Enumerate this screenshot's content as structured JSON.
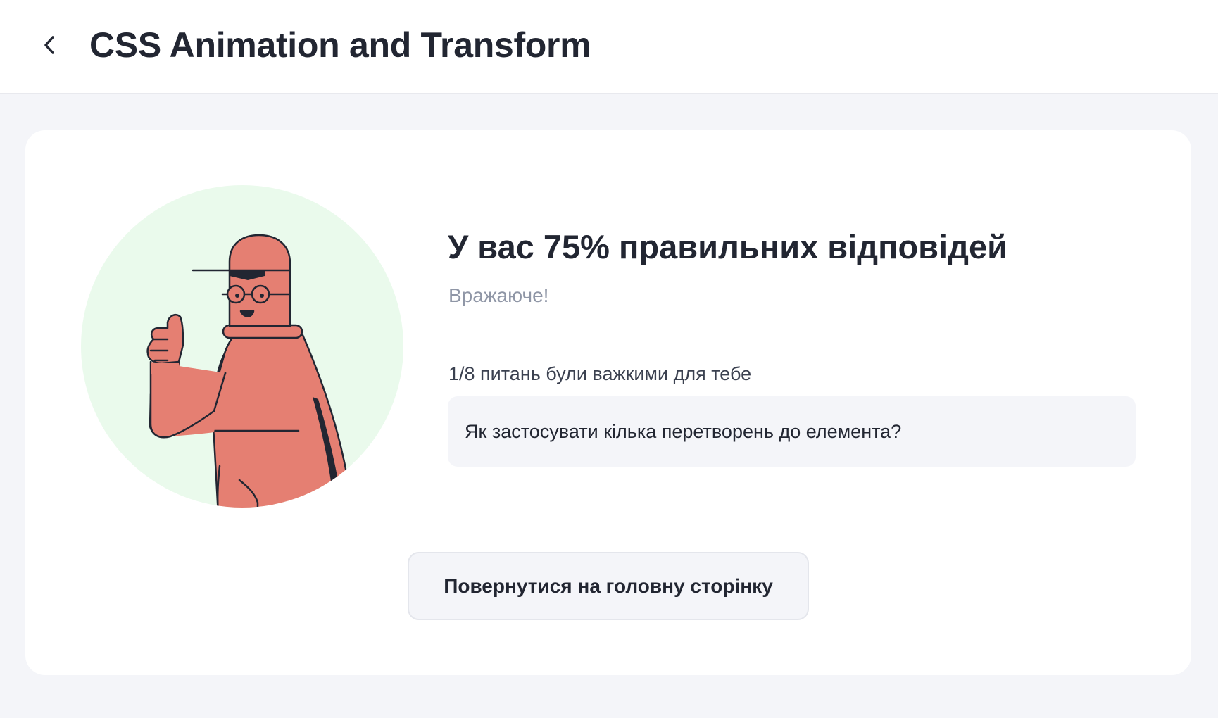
{
  "header": {
    "title": "CSS Animation and Transform",
    "back_icon": "chevron-left-icon"
  },
  "result": {
    "title": "У вас 75% правильних відповідей",
    "subtitle": "Вражаюче!",
    "hard_label": "1/8 питань були важкими для тебе",
    "hard_questions": [
      "Як застосувати кілька перетворень до елемента?"
    ],
    "illustration": "thumbs-up-character-illustration"
  },
  "actions": {
    "home_label": "Повернутися на головну сторінку"
  },
  "colors": {
    "page_background": "#f4f5f9",
    "card_background": "#ffffff",
    "circle_background": "#eafaec",
    "character_fill": "#e57f72",
    "outline": "#222632",
    "muted_text": "#8f96a6"
  }
}
